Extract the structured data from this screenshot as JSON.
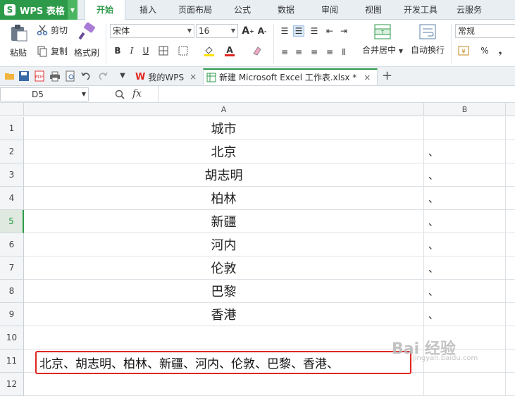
{
  "app": {
    "title": "WPS 表格",
    "logo_letter": "S"
  },
  "menu_tabs": [
    "开始",
    "插入",
    "页面布局",
    "公式",
    "数据",
    "审阅",
    "视图",
    "开发工具",
    "云服务"
  ],
  "active_tab": "开始",
  "ribbon": {
    "paste": "粘贴",
    "cut": "剪切",
    "copy": "复制",
    "format_painter": "格式刷",
    "font_name": "宋体",
    "font_size": "16",
    "bold": "B",
    "italic": "I",
    "underline": "U",
    "merge_center": "合并居中",
    "wrap_text": "自动换行",
    "number_format": "常规",
    "percent": "%",
    "comma": "❟"
  },
  "doc_tabs": [
    {
      "label": "我的WPS",
      "close": "×"
    },
    {
      "label": "新建 Microsoft Excel 工作表.xlsx *",
      "close": "×"
    }
  ],
  "new_tab": "+",
  "formula_bar": {
    "cell_ref": "D5",
    "fx": "fx",
    "value": ""
  },
  "sheet": {
    "columns": [
      "A",
      "B"
    ],
    "rows": [
      {
        "n": "1",
        "A": "城市",
        "B": ""
      },
      {
        "n": "2",
        "A": "北京",
        "B": "、"
      },
      {
        "n": "3",
        "A": "胡志明",
        "B": "、"
      },
      {
        "n": "4",
        "A": "柏林",
        "B": "、"
      },
      {
        "n": "5",
        "A": "新疆",
        "B": "、"
      },
      {
        "n": "6",
        "A": "河内",
        "B": "、"
      },
      {
        "n": "7",
        "A": "伦敦",
        "B": "、"
      },
      {
        "n": "8",
        "A": "巴黎",
        "B": "、"
      },
      {
        "n": "9",
        "A": "香港",
        "B": "、"
      },
      {
        "n": "10",
        "A": "",
        "B": ""
      },
      {
        "n": "11",
        "A": "北京、胡志明、柏林、新疆、河内、伦敦、巴黎、香港、",
        "B": ""
      },
      {
        "n": "12",
        "A": "",
        "B": ""
      }
    ],
    "selected_row": "5"
  },
  "watermark": {
    "text": "Bai 经验",
    "sub": "jingyan.baidu.com"
  },
  "colors": {
    "brand_green": "#2d9a4a",
    "highlight_red": "#e0261f"
  }
}
